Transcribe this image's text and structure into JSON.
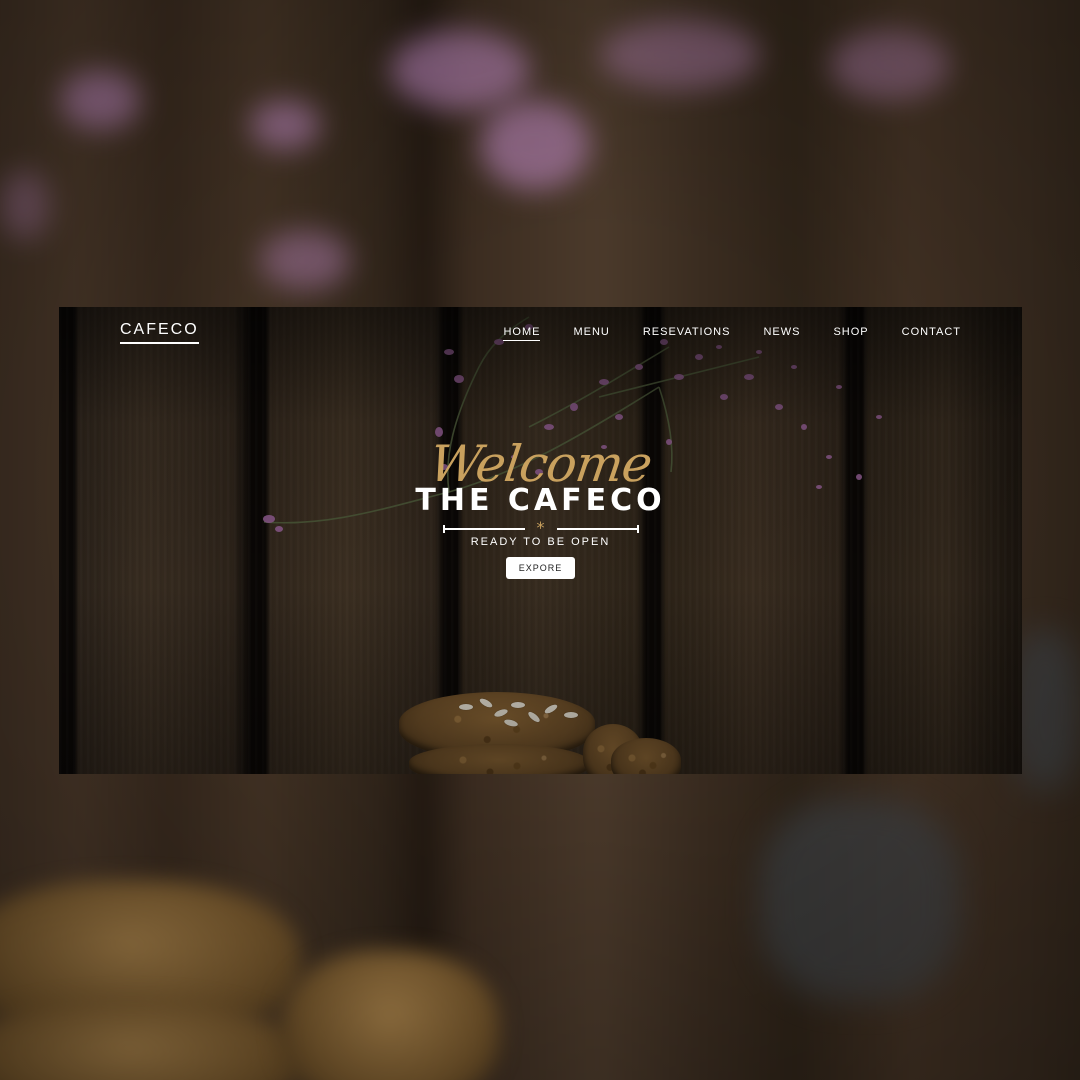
{
  "brand": {
    "logo": "CAFECO"
  },
  "nav": {
    "items": [
      {
        "label": "HOME",
        "active": true
      },
      {
        "label": "MENU"
      },
      {
        "label": "RESEVATIONS"
      },
      {
        "label": "NEWS"
      },
      {
        "label": "SHOP"
      },
      {
        "label": "CONTACT"
      }
    ]
  },
  "hero": {
    "script_heading": "Welcome",
    "title": "THE CAFECO",
    "ornament": "*",
    "tagline": "READY TO BE OPEN",
    "cta_label": "EXPORE"
  },
  "colors": {
    "accent_gold": "#c9a15e",
    "text_white": "#ffffff",
    "wood_dark": "#2f251b",
    "blossom_purple": "#b884b8"
  },
  "decor": {
    "background": "dark-wood-planks",
    "elements": [
      "lavender-branch",
      "glass-jar",
      "oat-cookies"
    ]
  }
}
